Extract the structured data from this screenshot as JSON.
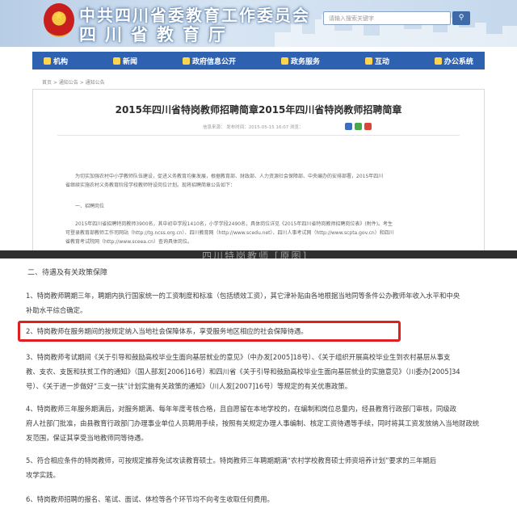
{
  "header": {
    "org_name": "中共四川省委教育工作委员会",
    "dept_name": "四川省教育厅",
    "search_placeholder": "请输入搜索关键字"
  },
  "nav": {
    "items": [
      {
        "label": "机构"
      },
      {
        "label": "新闻"
      },
      {
        "label": "政府信息公开"
      },
      {
        "label": "政务服务"
      },
      {
        "label": "互动"
      },
      {
        "label": "办公系统"
      }
    ]
  },
  "breadcrumb": "首页 > 通知公告 > 通知公告",
  "article": {
    "title": "2015年四川省特岗教师招聘简章2015年四川省特岗教师招聘简章",
    "meta": "信息来源：  发布时间：2015-05-15 16:07  浏览：",
    "intro_1": "为切实加强农村中小学教师队伍建设，促进义务教育均衡发展，根据教育部、财政部、人力资源社会保障部、中央编办的安排部署，2015年四川",
    "intro_2": "省继续实施农村义务教育阶段学校教师特设岗位计划。现将招聘简章公告如下：",
    "section_1": "一、招聘岗位",
    "body_1": "2015年四川省招聘特岗教师3900名，其中初中学段1410名，小学学段2490名，具体岗位详见《2015年四川省特岗教师招聘岗位表》(附件)。考生",
    "body_2": "可登录教育部教师工作司网站（http://tg.ncss.org.cn）、四川教育网（http://www.scedu.net）、四川人事考试网（http://www.scpta.gov.cn）和四川",
    "body_3": "省教育考试院网（http://www.sceea.cn）查询具体岗位。"
  },
  "watermark": "四川特岗教师 [原图]",
  "detail": {
    "heading": "二、待遇及有关政策保障",
    "p1_l1": "1、特岗教师聘期三年，聘期内执行国家统一的工资制度和标准（包括绩效工资），其它津补贴由各地根据当地同等条件公办教师年收入水平和中央",
    "p1_l2": "补助水平综合确定。",
    "p2": "2、特岗教师在服务期间的按规定纳入当地社会保障体系，享受服务地区相应的社会保障待遇。",
    "p3_l1": "3、特岗教师考试期间《关于引导和鼓励高校毕业生面向基层就业的意见》（中办发[2005]18号）、《关于组织开展高校毕业生到农村基层从事支",
    "p3_l2": "教、支农、支医和扶贫工作的通知》（国人部发[2006]16号）和四川省《关于引导和鼓励高校毕业生面向基层就业的实施意见》（川委办[2005]34",
    "p3_l3": "号）、《关于进一步做好“三支一扶”计划实施有关政策的通知》（川人发[2007]16号）等规定的有关优惠政策。",
    "p4_l1": "4、特岗教师三年服务期满后，对服务期满、每年年度考核合格，且自愿留在本地学校的，在编制和岗位总量内，经县教育行政部门审核，同级政",
    "p4_l2": "府人社部门批准，由县教育行政部门办理事业单位人员聘用手续，按照有关规定办理人事编制、核定工资待遇等手续，同时将其工资发放纳入当地财政统",
    "p4_l3": "发范围，保证其享受当地教师同等待遇。",
    "p5_l1": "5、符合相应条件的特岗教师，可按规定推荐免试攻读教育硕士。特岗教师三年聘期期满“农村学校教育硕士师资培养计划”要求的三年期后",
    "p5_l2": "攻学实践。",
    "p6": "6、特岗教师招聘的报名、笔试、面试、体检等各个环节均不向考生收取任何费用。"
  }
}
